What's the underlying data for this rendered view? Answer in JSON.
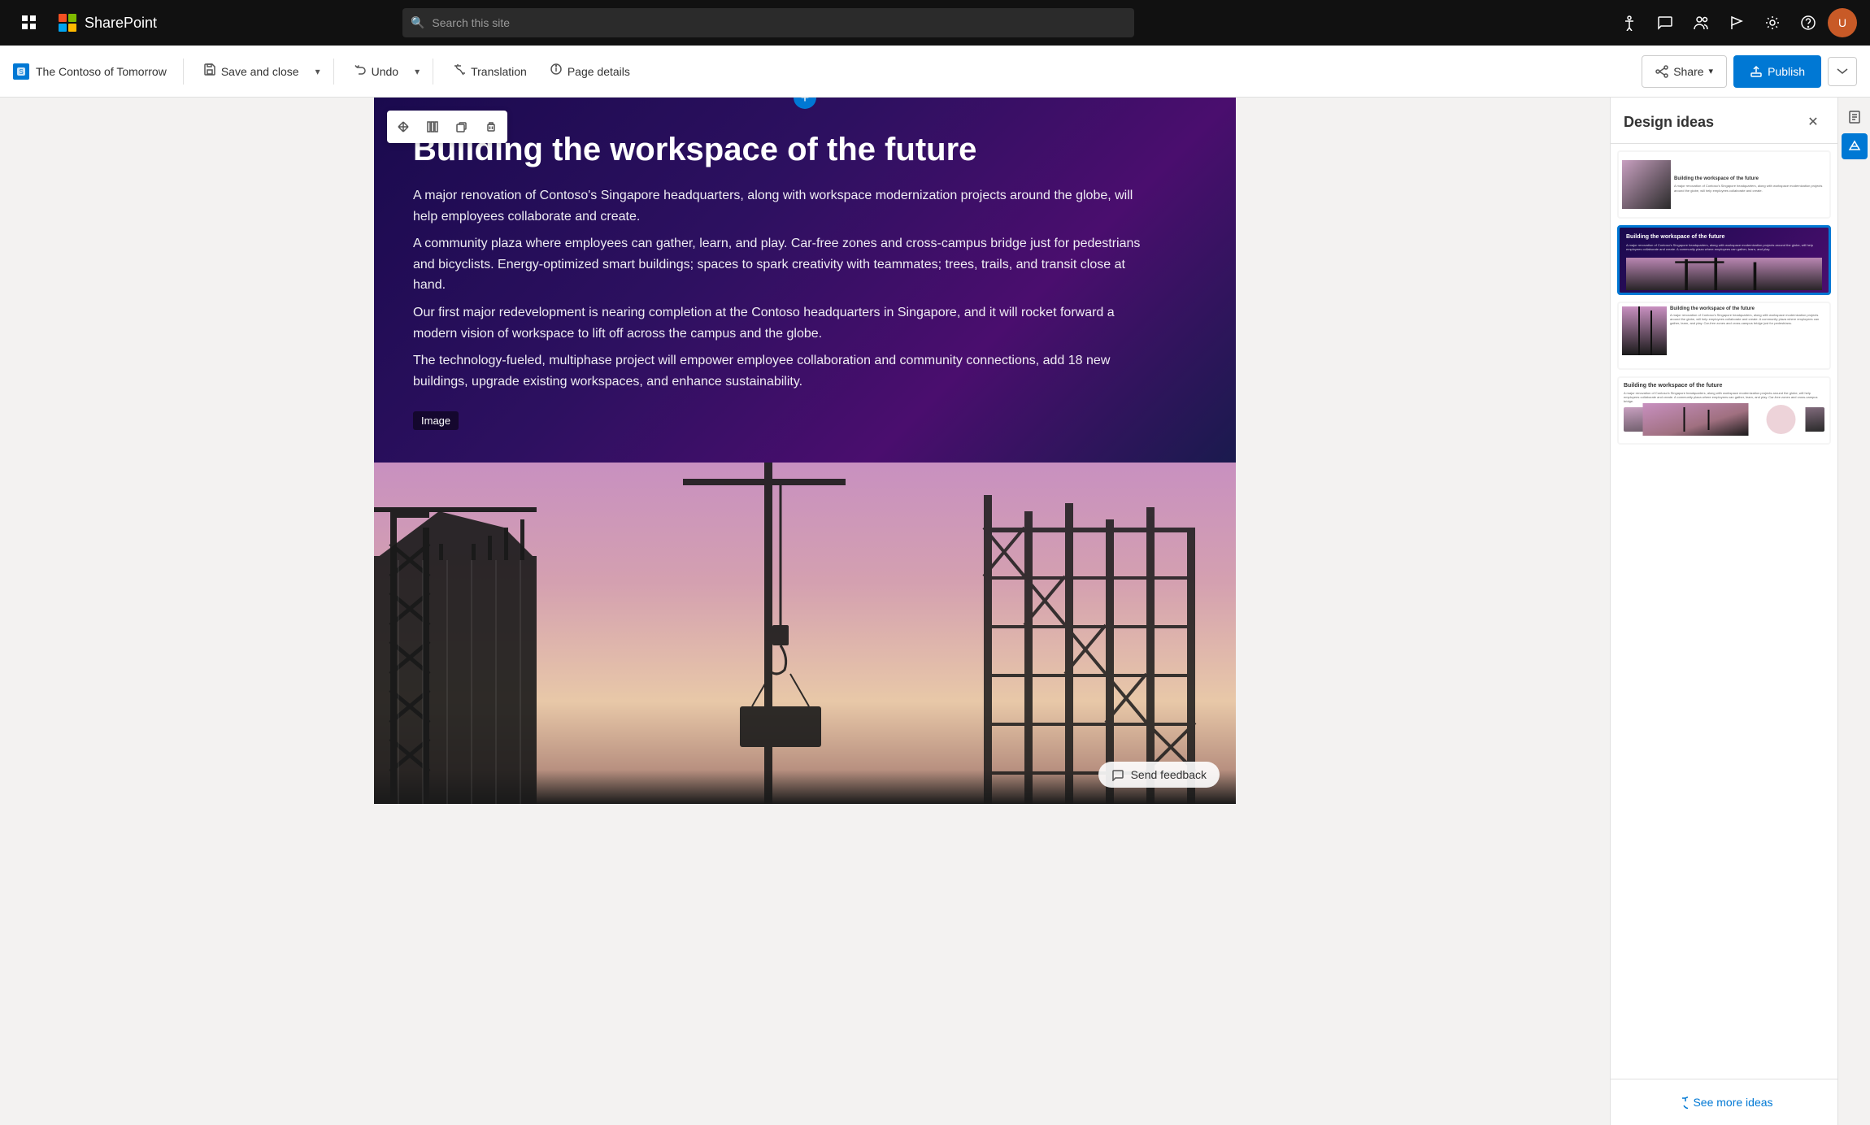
{
  "topNav": {
    "appName": "SharePoint",
    "searchPlaceholder": "Search this site",
    "icons": [
      "apps-grid",
      "chat",
      "people",
      "flag",
      "settings",
      "help"
    ],
    "avatarInitial": "U"
  },
  "toolbar": {
    "brandName": "The Contoso of Tomorrow",
    "saveAndClose": "Save and close",
    "undo": "Undo",
    "translation": "Translation",
    "pageDetails": "Page details",
    "share": "Share",
    "publish": "Publish"
  },
  "canvas": {
    "addSectionLabel": "+",
    "sectionTools": [
      "move",
      "columns",
      "duplicate",
      "delete"
    ],
    "pageTitle": "Building the workspace of the future",
    "pageBody1": "A major renovation of Contoso's Singapore headquarters, along with workspace modernization projects around the globe, will help employees collaborate and create.",
    "pageBody2": "A community plaza where employees can gather, learn, and play. Car-free zones and cross-campus bridge just for pedestrians and bicyclists. Energy-optimized smart buildings; spaces to spark creativity with teammates; trees, trails, and transit close at hand.",
    "pageBody3": "Our first major redevelopment is nearing completion at the Contoso headquarters in Singapore, and it will rocket forward a modern vision of workspace to lift off across the campus and the globe.",
    "pageBody4": "The technology-fueled, multiphase project will empower employee collaboration and community connections, add 18 new buildings, upgrade existing workspaces, and enhance sustainability.",
    "imageLabel": "Image",
    "sendFeedback": "Send feedback"
  },
  "designPanel": {
    "title": "Design ideas",
    "seeMore": "See more ideas",
    "ideas": [
      {
        "id": 1,
        "selected": false
      },
      {
        "id": 2,
        "selected": true
      },
      {
        "id": 3,
        "selected": false
      },
      {
        "id": 4,
        "selected": false
      }
    ]
  }
}
